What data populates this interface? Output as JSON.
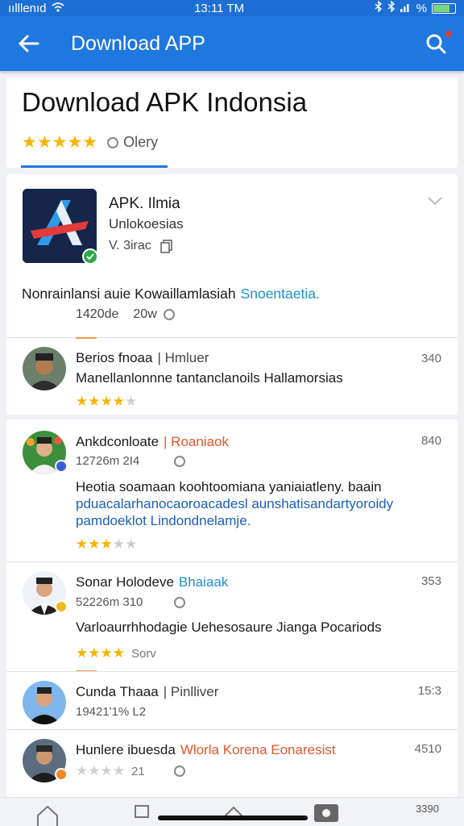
{
  "status_bar": {
    "carrier": "ıılllenıd",
    "time": "13:11 TM"
  },
  "app_bar": {
    "title": "Download APP"
  },
  "header": {
    "title": "Download APK Indonsia",
    "filter_label": "Olery"
  },
  "app": {
    "name": "APK. Ilmia",
    "developer": "Unlokoesias",
    "version": "V. 3irac",
    "description": "Nonrainlansi auie Kowaillamlasiah",
    "description_link": "Snoentaetia.",
    "meta_size": "1420de",
    "meta_count": "20w"
  },
  "reviews": [
    {
      "name": "Berios fnoaa",
      "tag": "| Hmluer",
      "count": "340",
      "text_lines": [
        "Manellanlonnne tantanclanoils Hallamorsias"
      ],
      "rating": 4
    },
    {
      "name": "Ankdconloate",
      "tag": "| Roaniaok",
      "count": "840",
      "date": "12726m 2I4",
      "text_lines": [
        "Heotia soamaan koohtoomiana yaniaiatleny. baain",
        "pduacalarhanocaoroacadesl aunshatisandartyoroidy",
        "pamdoeklot Lindondnelamje."
      ],
      "rating": 3
    },
    {
      "name": "Sonar Holodeve",
      "tag": "Bhaiaak",
      "count": "353",
      "date": "52226m 310",
      "text_lines": [
        "Varloaurrhhodagie Uehesosaure Jianga Pocariods"
      ],
      "rating": 4,
      "extra": "Sorv"
    },
    {
      "name": "Cunda Thaaa",
      "tag": "| Pinlliver",
      "count": "15:3",
      "date": "19421'1% L2",
      "rating": 0
    },
    {
      "name": "Hunlere ibuesda",
      "tag": "Wlorla Korena Eonaresist",
      "count": "4510",
      "rating": 0,
      "extra": "21"
    }
  ],
  "bottom_bar": {
    "corner_label": "3390"
  },
  "colors": {
    "primary": "#1f77e0",
    "star": "#f5b400",
    "link": "#1d8fd1",
    "accent_red": "#e0562a"
  }
}
